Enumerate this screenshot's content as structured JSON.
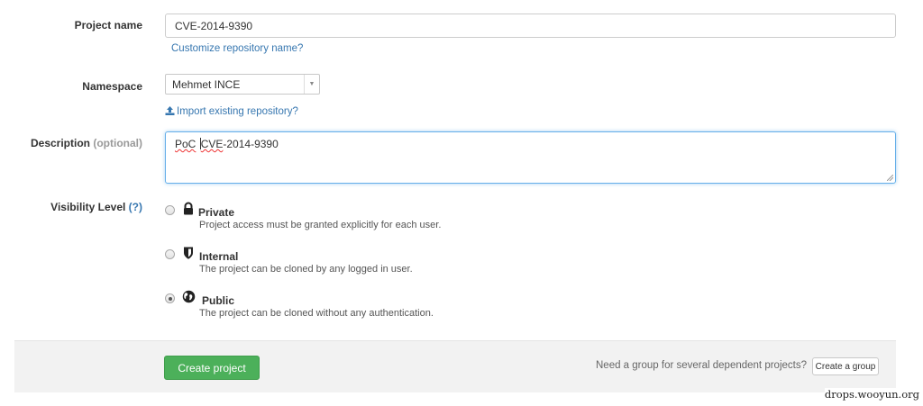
{
  "form": {
    "project_name": {
      "label": "Project name",
      "value": "CVE-2014-9390",
      "link": "Customize repository name?"
    },
    "namespace": {
      "label": "Namespace",
      "selected": "Mehmet INCE",
      "import_link": "Import existing repository?",
      "import_icon": "upload-icon"
    },
    "description": {
      "label": "Description",
      "optional": "(optional)",
      "value_word1": "PoC",
      "value_word2": "CVE",
      "value_rest": "-2014-9390"
    },
    "visibility": {
      "label": "Visibility Level",
      "help": "(?)",
      "options": [
        {
          "title": "Private",
          "desc": "Project access must be granted explicitly for each user.",
          "icon": "lock-icon",
          "checked": false
        },
        {
          "title": "Internal",
          "desc": "The project can be cloned by any logged in user.",
          "icon": "shield-icon",
          "checked": false
        },
        {
          "title": "Public",
          "desc": "The project can be cloned without any authentication.",
          "icon": "globe-icon",
          "checked": true
        }
      ]
    }
  },
  "footer": {
    "create_button": "Create project",
    "group_prompt": "Need a group for several dependent projects?",
    "group_button": "Create a group"
  },
  "watermark": "drops.wooyun.org",
  "colors": {
    "link": "#3777b0",
    "primary_green": "#4cb05a",
    "focus_border": "#66afe9",
    "footer_bg": "#f2f2f2"
  }
}
